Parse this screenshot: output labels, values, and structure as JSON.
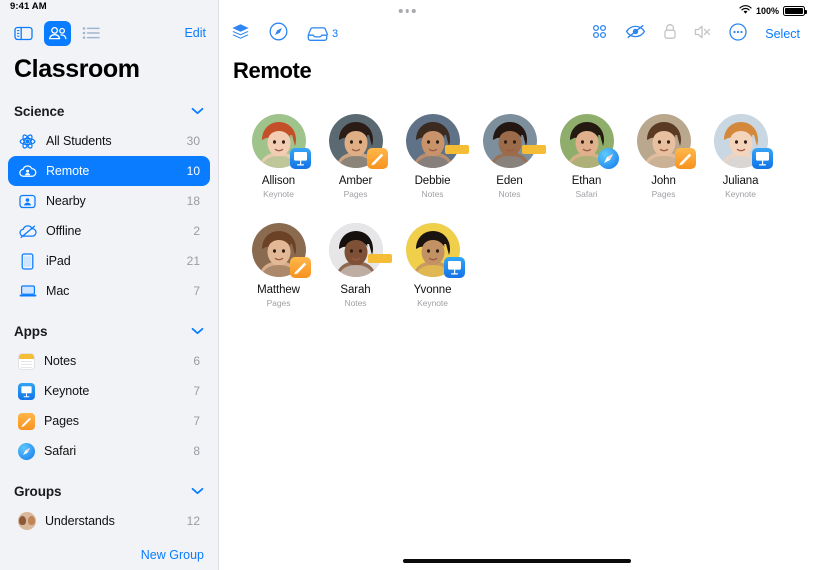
{
  "statusbar": {
    "time": "9:41 AM",
    "battery_pct": "100%",
    "wifi_icon": "wifi-icon",
    "battery_icon": "battery-icon"
  },
  "sidebar": {
    "toolbar": {
      "sidebar_toggle_icon": "sidebar-toggle-icon",
      "people_icon": "people-icon",
      "list_icon": "list-icon",
      "edit_label": "Edit"
    },
    "title": "Classroom",
    "sections": [
      {
        "label": "Science",
        "chevron_icon": "chevron-down-icon",
        "items": [
          {
            "label": "All Students",
            "count": "30",
            "icon": "atom-icon",
            "selected": false
          },
          {
            "label": "Remote",
            "count": "10",
            "icon": "cloud-person-icon",
            "selected": true
          },
          {
            "label": "Nearby",
            "count": "18",
            "icon": "person-badge-icon",
            "selected": false
          },
          {
            "label": "Offline",
            "count": "2",
            "icon": "cloud-slash-icon",
            "selected": false
          },
          {
            "label": "iPad",
            "count": "21",
            "icon": "ipad-icon",
            "selected": false
          },
          {
            "label": "Mac",
            "count": "7",
            "icon": "laptop-icon",
            "selected": false
          }
        ]
      },
      {
        "label": "Apps",
        "chevron_icon": "chevron-down-icon",
        "items": [
          {
            "label": "Notes",
            "count": "6",
            "icon": "notes-app-icon",
            "selected": false
          },
          {
            "label": "Keynote",
            "count": "7",
            "icon": "keynote-app-icon",
            "selected": false
          },
          {
            "label": "Pages",
            "count": "7",
            "icon": "pages-app-icon",
            "selected": false
          },
          {
            "label": "Safari",
            "count": "8",
            "icon": "safari-app-icon",
            "selected": false
          }
        ]
      },
      {
        "label": "Groups",
        "chevron_icon": "chevron-down-icon",
        "items": [
          {
            "label": "Understands",
            "count": "12",
            "icon": "group-faces-icon",
            "selected": false
          }
        ]
      }
    ],
    "new_group_label": "New Group"
  },
  "main": {
    "toolbar": {
      "layers_icon": "layers-icon",
      "compass_icon": "compass-icon",
      "inbox_icon": "inbox-tray-icon",
      "inbox_count": "3",
      "grid_icon": "grid-four-dots-icon",
      "hide_icon": "eye-slash-icon",
      "lock_icon": "lock-icon",
      "mute_icon": "speaker-mute-icon",
      "more_icon": "more-circle-icon",
      "select_label": "Select"
    },
    "title": "Remote",
    "students": [
      {
        "name": "Allison",
        "app": "Keynote",
        "badge": "keynote",
        "hair": "#c4502a",
        "skin": "#f2cdb4",
        "bg": "#9fc48b"
      },
      {
        "name": "Amber",
        "app": "Pages",
        "badge": "pages",
        "hair": "#2b1c16",
        "skin": "#dfae84",
        "bg": "#5b6a72"
      },
      {
        "name": "Debbie",
        "app": "Notes",
        "badge": "notes",
        "hair": "#3a2a20",
        "skin": "#c8936a",
        "bg": "#5f7287"
      },
      {
        "name": "Eden",
        "app": "Notes",
        "badge": "notes",
        "hair": "#241712",
        "skin": "#9c6b4a",
        "bg": "#7d8f9c"
      },
      {
        "name": "Ethan",
        "app": "Safari",
        "badge": "safari",
        "hair": "#241a12",
        "skin": "#e0b08c",
        "bg": "#8fae6b"
      },
      {
        "name": "John",
        "app": "Pages",
        "badge": "pages",
        "hair": "#5a3a22",
        "skin": "#e8c0a0",
        "bg": "#b9a88e"
      },
      {
        "name": "Juliana",
        "app": "Keynote",
        "badge": "keynote",
        "hair": "#d4883c",
        "skin": "#f5d4bc",
        "bg": "#c9d7e3"
      },
      {
        "name": "Matthew",
        "app": "Pages",
        "badge": "pages",
        "hair": "#6b4226",
        "skin": "#e3b896",
        "bg": "#8b6b4f"
      },
      {
        "name": "Sarah",
        "app": "Notes",
        "badge": "notes",
        "hair": "#15100d",
        "skin": "#7e5136",
        "bg": "#e6e6e8"
      },
      {
        "name": "Yvonne",
        "app": "Keynote",
        "badge": "keynote",
        "hair": "#1c1410",
        "skin": "#c39264",
        "bg": "#f0cf4a"
      }
    ]
  },
  "colors": {
    "accent": "#0a7cff",
    "sidebar_bg": "#f2f3f7",
    "muted": "#9b9ba1",
    "disabled": "#c3c3c8"
  }
}
